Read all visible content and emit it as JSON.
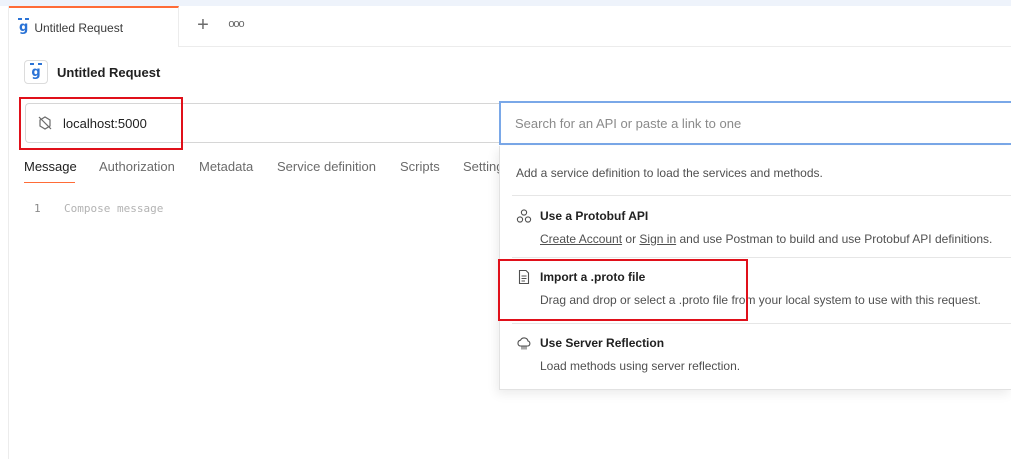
{
  "tab": {
    "label": "Untitled Request"
  },
  "request": {
    "title": "Untitled Request"
  },
  "url": {
    "value": "localhost:5000"
  },
  "search": {
    "placeholder": "Search for an API or paste a link to one"
  },
  "subtabs": [
    {
      "label": "Message"
    },
    {
      "label": "Authorization"
    },
    {
      "label": "Metadata"
    },
    {
      "label": "Service definition"
    },
    {
      "label": "Scripts"
    },
    {
      "label": "Settings"
    }
  ],
  "editor": {
    "line_number": "1",
    "placeholder": "Compose message"
  },
  "dropdown": {
    "intro": "Add a service definition to load the services and methods.",
    "protobuf": {
      "title": "Use a Protobuf API",
      "create_account": "Create Account",
      "or": "or",
      "sign_in": "Sign in",
      "rest": "and use Postman to build and use Protobuf API definitions."
    },
    "proto_file": {
      "title": "Import a .proto file",
      "desc": "Drag and drop or select a .proto file from your local system to use with this request."
    },
    "reflection": {
      "title": "Use Server Reflection",
      "desc": "Load methods using server reflection."
    }
  },
  "icons": {
    "grpc": "grpc-icon",
    "plus": "plus-icon",
    "more": "more-horizontal-icon",
    "disconnected": "disconnected-icon",
    "protobuf": "protobuf-nodes-icon",
    "file": "file-icon",
    "reflection": "cloud-reflection-icon"
  },
  "colors": {
    "accent": "#ff6c37",
    "focus_border": "#7aa8e8",
    "grpc_blue": "#2b73d6",
    "annotation": "#e0101a"
  }
}
